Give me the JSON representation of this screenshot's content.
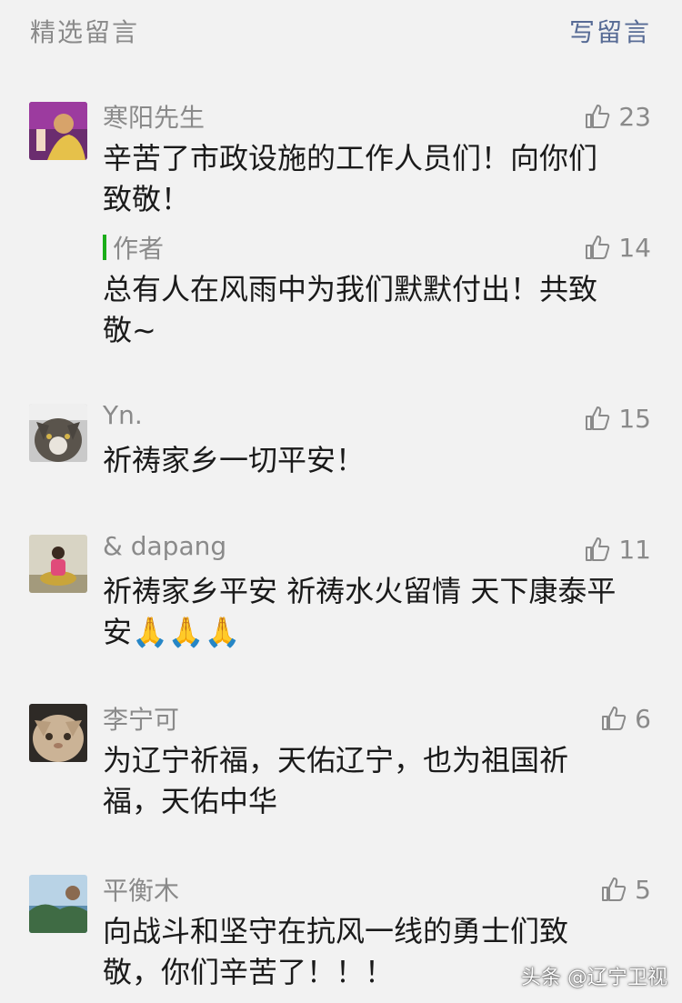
{
  "header": {
    "title": "精选留言",
    "write_label": "写留言"
  },
  "comments": [
    {
      "nickname": "寒阳先生",
      "text": "辛苦了市政设施的工作人员们！向你们\n致敬！",
      "likes": "23",
      "reply": {
        "label": "作者",
        "text": "总有人在风雨中为我们默默付出！共致\n敬~",
        "likes": "14"
      }
    },
    {
      "nickname": "Yn.",
      "text": "祈祷家乡一切平安！",
      "likes": "15"
    },
    {
      "nickname": "& dapang",
      "text": "祈祷家乡平安 祈祷水火留情 天下康泰平\n安🙏🙏🙏",
      "likes": "11"
    },
    {
      "nickname": "李宁可",
      "text": "为辽宁祈福，天佑辽宁，也为祖国祈\n福，天佑中华",
      "likes": "6"
    },
    {
      "nickname": "平衡木",
      "text": "向战斗和坚守在抗风一线的勇士们致\n敬，你们辛苦了！！！",
      "likes": "5"
    }
  ],
  "watermark": "头条 @辽宁卫视",
  "colors": {
    "link": "#576b95",
    "author_bar": "#1aad19",
    "muted": "#8a8a8a",
    "background": "#f2f2f2"
  }
}
